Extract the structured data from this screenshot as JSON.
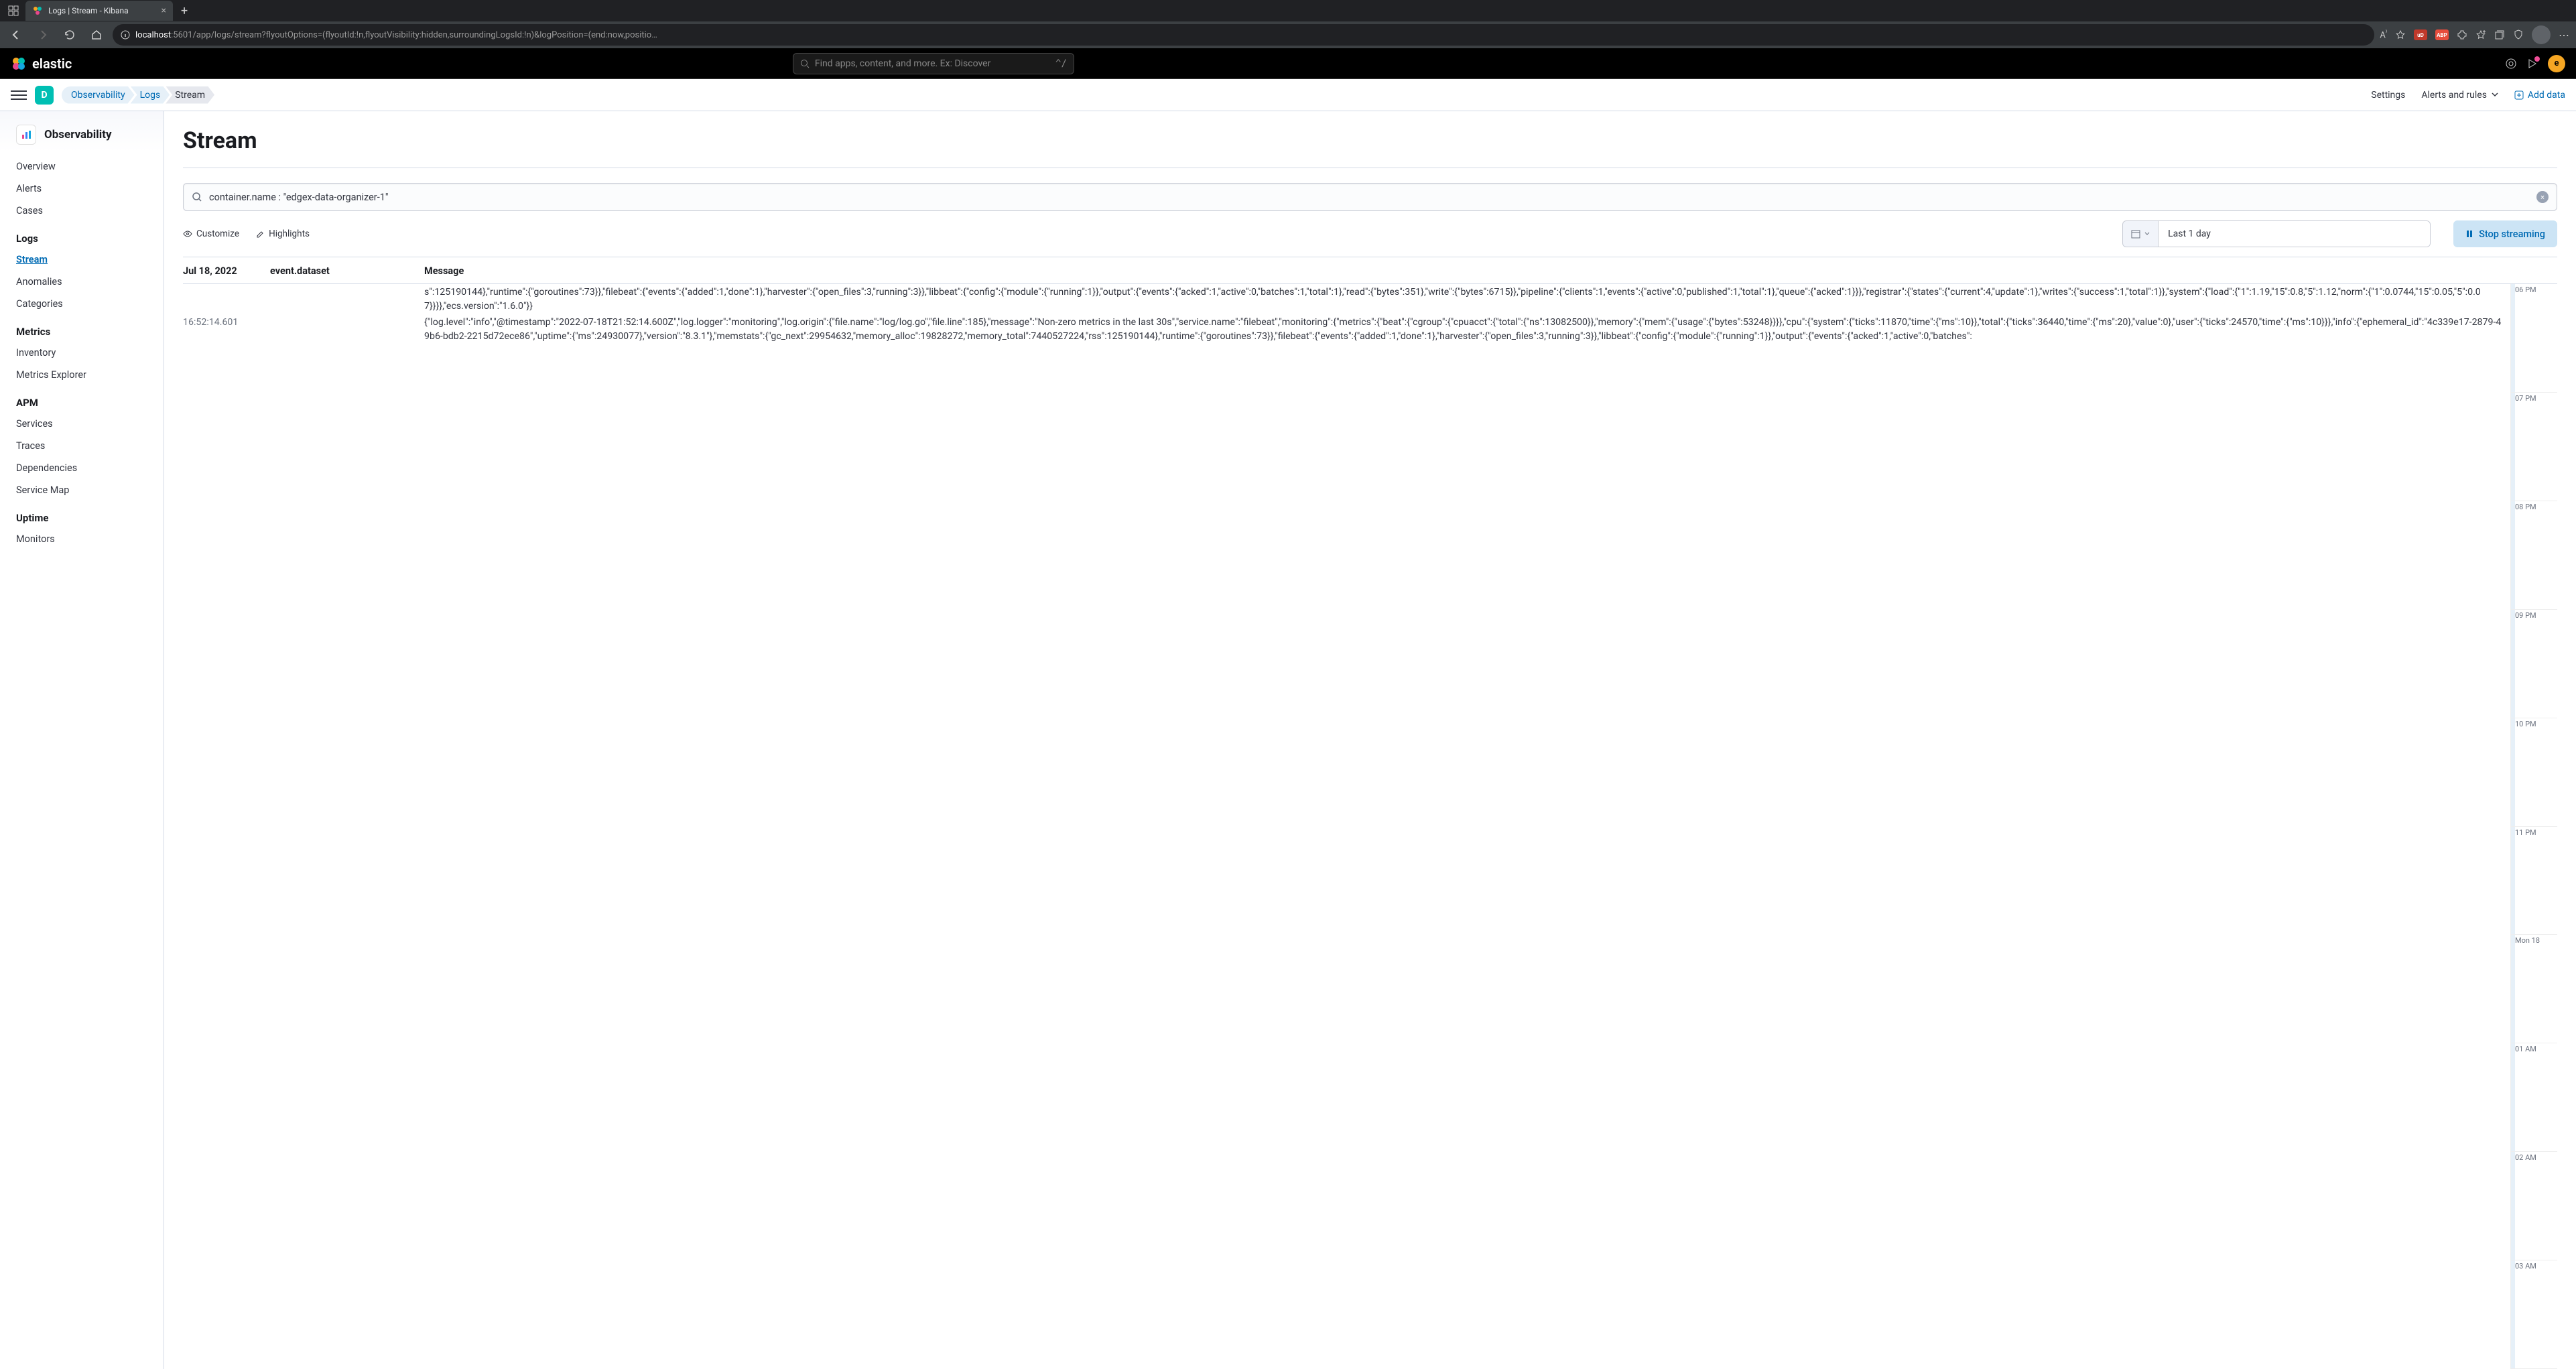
{
  "browser": {
    "tab_title": "Logs | Stream - Kibana",
    "url_host": "localhost",
    "url_path": ":5601/app/logs/stream?flyoutOptions=(flyoutId:!n,flyoutVisibility:hidden,surroundingLogsId:!n)&logPosition=(end:now,positio…"
  },
  "kbn_header": {
    "search_placeholder": "Find apps, content, and more. Ex: Discover",
    "kbd_hint": "^/",
    "user_initial": "e"
  },
  "sub_header": {
    "space_letter": "D",
    "crumbs": [
      "Observability",
      "Logs",
      "Stream"
    ],
    "settings": "Settings",
    "alerts": "Alerts and rules",
    "add_data": "Add data"
  },
  "sidebar": {
    "title": "Observability",
    "items": [
      {
        "type": "item",
        "label": "Overview"
      },
      {
        "type": "item",
        "label": "Alerts"
      },
      {
        "type": "item",
        "label": "Cases"
      },
      {
        "type": "group",
        "label": "Logs"
      },
      {
        "type": "item",
        "label": "Stream",
        "active": true
      },
      {
        "type": "item",
        "label": "Anomalies"
      },
      {
        "type": "item",
        "label": "Categories"
      },
      {
        "type": "group",
        "label": "Metrics"
      },
      {
        "type": "item",
        "label": "Inventory"
      },
      {
        "type": "item",
        "label": "Metrics Explorer"
      },
      {
        "type": "group",
        "label": "APM"
      },
      {
        "type": "item",
        "label": "Services"
      },
      {
        "type": "item",
        "label": "Traces"
      },
      {
        "type": "item",
        "label": "Dependencies"
      },
      {
        "type": "item",
        "label": "Service Map"
      },
      {
        "type": "group",
        "label": "Uptime"
      },
      {
        "type": "item",
        "label": "Monitors"
      }
    ]
  },
  "page": {
    "title": "Stream",
    "query": "container.name : \"edgex-data-organizer-1\"",
    "customize": "Customize",
    "highlights": "Highlights",
    "time_range": "Last 1 day",
    "stop_streaming": "Stop streaming"
  },
  "table": {
    "head_date": "Jul 18, 2022",
    "head_dataset": "event.dataset",
    "head_message": "Message",
    "rows": [
      {
        "time": "",
        "msg": "s\":125190144},\"runtime\":{\"goroutines\":73}},\"filebeat\":{\"events\":{\"added\":1,\"done\":1},\"harvester\":{\"open_files\":3,\"running\":3}},\"libbeat\":{\"config\":{\"module\":{\"running\":1}},\"output\":{\"events\":{\"acked\":1,\"active\":0,\"batches\":1,\"total\":1},\"read\":{\"bytes\":351},\"write\":{\"bytes\":6715}},\"pipeline\":{\"clients\":1,\"events\":{\"active\":0,\"published\":1,\"total\":1},\"queue\":{\"acked\":1}}},\"registrar\":{\"states\":{\"current\":4,\"update\":1},\"writes\":{\"success\":1,\"total\":1}},\"system\":{\"load\":{\"1\":1.19,\"15\":0.8,\"5\":1.12,\"norm\":{\"1\":0.0744,\"15\":0.05,\"5\":0.07}}}},\"ecs.version\":\"1.6.0\"}}"
      },
      {
        "time": "16:52:14.601",
        "msg": "{\"log.level\":\"info\",\"@timestamp\":\"2022-07-18T21:52:14.600Z\",\"log.logger\":\"monitoring\",\"log.origin\":{\"file.name\":\"log/log.go\",\"file.line\":185},\"message\":\"Non-zero metrics in the last 30s\",\"service.name\":\"filebeat\",\"monitoring\":{\"metrics\":{\"beat\":{\"cgroup\":{\"cpuacct\":{\"total\":{\"ns\":13082500}},\"memory\":{\"mem\":{\"usage\":{\"bytes\":53248}}}},\"cpu\":{\"system\":{\"ticks\":11870,\"time\":{\"ms\":10}},\"total\":{\"ticks\":36440,\"time\":{\"ms\":20},\"value\":0},\"user\":{\"ticks\":24570,\"time\":{\"ms\":10}}},\"info\":{\"ephemeral_id\":\"4c339e17-2879-49b6-bdb2-2215d72ece86\",\"uptime\":{\"ms\":24930077},\"version\":\"8.3.1\"},\"memstats\":{\"gc_next\":29954632,\"memory_alloc\":19828272,\"memory_total\":7440527224,\"rss\":125190144},\"runtime\":{\"goroutines\":73}},\"filebeat\":{\"events\":{\"added\":1,\"done\":1},\"harvester\":{\"open_files\":3,\"running\":3}},\"libbeat\":{\"config\":{\"module\":{\"running\":1}},\"output\":{\"events\":{\"acked\":1,\"active\":0,\"batches\":"
      }
    ]
  },
  "timeline": [
    "06 PM",
    "07 PM",
    "08 PM",
    "09 PM",
    "10 PM",
    "11 PM",
    "Mon 18",
    "01 AM",
    "02 AM",
    "03 AM"
  ]
}
